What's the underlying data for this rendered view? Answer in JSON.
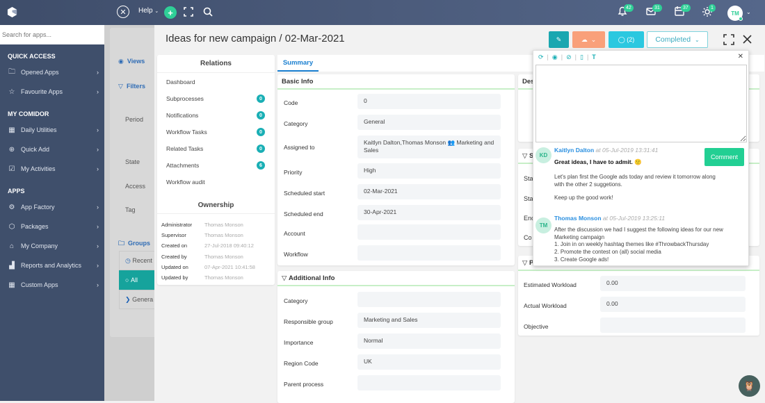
{
  "topbar": {
    "help_label": "Help",
    "notifications_count": "42",
    "messages_count": "31",
    "calendar_count": "37",
    "activity_count": "1",
    "avatar_initials": "TM"
  },
  "sidebar": {
    "search_placeholder": "Search for apps...",
    "sections": [
      {
        "title": "QUICK ACCESS",
        "items": [
          {
            "label": "Opened Apps"
          },
          {
            "label": "Favourite Apps"
          }
        ]
      },
      {
        "title": "MY COMIDOR",
        "items": [
          {
            "label": "Daily Utilities"
          },
          {
            "label": "Quick Add"
          },
          {
            "label": "My Activities"
          }
        ]
      },
      {
        "title": "APPS",
        "items": [
          {
            "label": "App Factory"
          },
          {
            "label": "Packages"
          },
          {
            "label": "My Company"
          },
          {
            "label": "Reports and Analytics"
          },
          {
            "label": "Custom Apps"
          }
        ]
      }
    ]
  },
  "background_panel": {
    "views_label": "Views",
    "filters_label": "Filters",
    "filters": [
      "Period",
      "State",
      "Access",
      "Tag"
    ],
    "groups_label": "Groups",
    "groups": [
      "Recent",
      "All",
      "Genera"
    ]
  },
  "record": {
    "title": "Ideas for new campaign / 02-Mar-2021",
    "comments_label": "(2)",
    "status": "Completed"
  },
  "relations": {
    "title": "Relations",
    "items": [
      {
        "label": "Dashboard",
        "count": null
      },
      {
        "label": "Subprocesses",
        "count": "0"
      },
      {
        "label": "Notifications",
        "count": "0"
      },
      {
        "label": "Workflow Tasks",
        "count": "0"
      },
      {
        "label": "Related Tasks",
        "count": "0"
      },
      {
        "label": "Attachments",
        "count": "6"
      },
      {
        "label": "Workflow audit",
        "count": null
      }
    ]
  },
  "ownership": {
    "title": "Ownership",
    "rows": [
      {
        "label": "Administrator",
        "value": "Thomas Monson"
      },
      {
        "label": "Supervisor",
        "value": "Thomas Monson"
      },
      {
        "label": "Created on",
        "value": "27-Jul-2018 09:40:12"
      },
      {
        "label": "Created by",
        "value": "Thomas Monson"
      },
      {
        "label": "Updated on",
        "value": "07-Apr-2021 10:41:58"
      },
      {
        "label": "Updated by",
        "value": "Thomas Monson"
      }
    ]
  },
  "tabs": {
    "summary": "Summary"
  },
  "basic_info": {
    "title": "Basic Info",
    "fields": [
      {
        "label": "Code",
        "value": "0"
      },
      {
        "label": "Category",
        "value": "General"
      },
      {
        "label": "Assigned to",
        "value": "Kaitlyn Dalton,Thomas Monson 👥 Marketing and Sales"
      },
      {
        "label": "Priority",
        "value": "High"
      },
      {
        "label": "Scheduled start",
        "value": "02-Mar-2021"
      },
      {
        "label": "Scheduled end",
        "value": "30-Apr-2021"
      },
      {
        "label": "Account",
        "value": ""
      },
      {
        "label": "Workflow",
        "value": ""
      }
    ]
  },
  "additional_info": {
    "title": "Additional Info",
    "fields": [
      {
        "label": "Category",
        "value": ""
      },
      {
        "label": "Responsible group",
        "value": "Marketing and Sales"
      },
      {
        "label": "Importance",
        "value": "Normal"
      },
      {
        "label": "Region Code",
        "value": "UK"
      },
      {
        "label": "Parent process",
        "value": ""
      }
    ]
  },
  "right_panel": {
    "description_title": "Des",
    "section2_title": "S",
    "section2_labels": [
      "Sta",
      "Sta",
      "Enc",
      "Co"
    ],
    "section3_title": "P",
    "fields": [
      {
        "label": "Estimated Workload",
        "value": "0.00"
      },
      {
        "label": "Actual Workload",
        "value": "0.00"
      },
      {
        "label": "Objective",
        "value": ""
      }
    ]
  },
  "comments_popup": {
    "comment_button": "Comment",
    "comments": [
      {
        "initials": "KD",
        "author": "Kaitlyn Dalton",
        "time": "at 05-Jul-2019 13:31:41",
        "headline": "Great ideas, I have to admit. 🙂",
        "lines": [
          "Let's plan first the Google ads today and review it tomorrow along with the other 2 suggetions.",
          "Keep up the good work!"
        ]
      },
      {
        "initials": "TM",
        "author": "Thomas Monson",
        "time": "at 05-Jul-2019 13:25:11",
        "lines": [
          "After the discussion we had I suggest the following ideas for our new Marketing campaign",
          "1. Join in on weekly hashtag themes like #ThrowbackThursday",
          "2. Promote the contest on (all) social media",
          "3. Create Google ads!"
        ]
      }
    ]
  },
  "colors": {
    "topbar": "#46567a",
    "sidebar": "#3f4f6b",
    "accent_teal": "#1aafb5",
    "accent_green": "#22cf93",
    "accent_orange": "#f9a07a",
    "accent_cyan": "#2bc8e0",
    "link_blue": "#1a7fd0"
  }
}
